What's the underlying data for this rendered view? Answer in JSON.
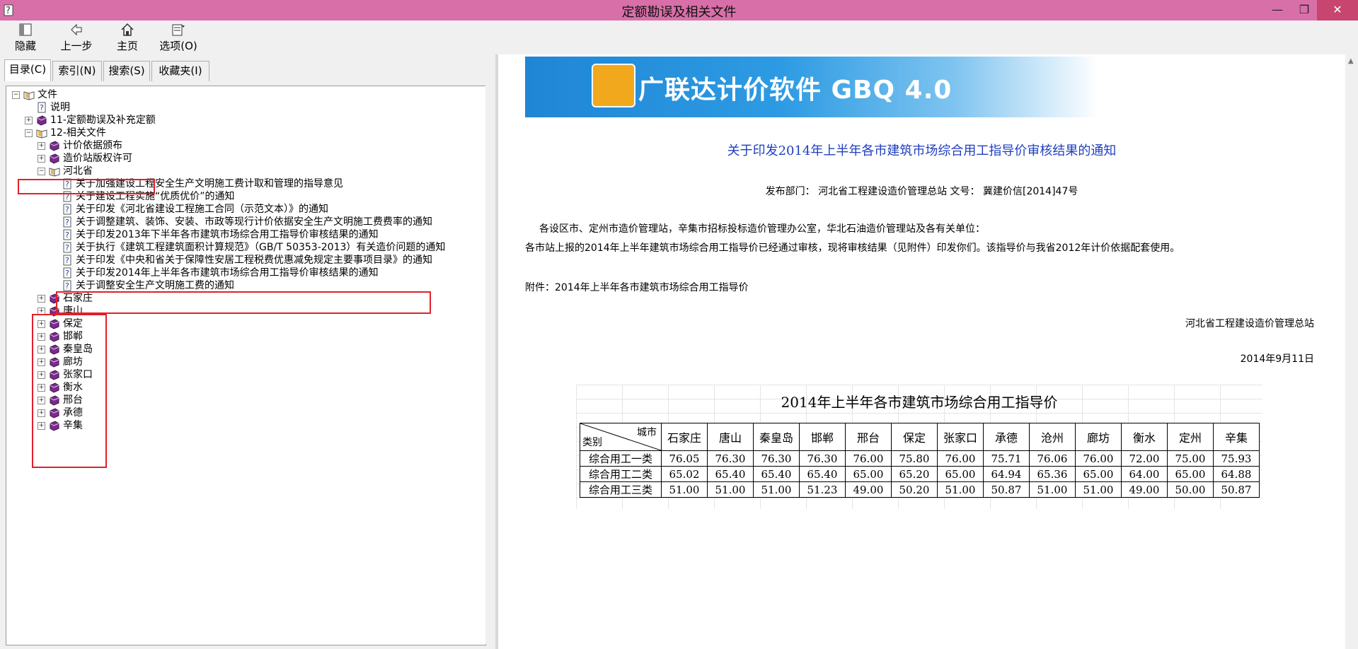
{
  "window": {
    "title": "定额勘误及相关文件"
  },
  "toolbar": [
    {
      "label": "隐藏",
      "icon": "hide-icon"
    },
    {
      "label": "上一步",
      "icon": "back-arrow-icon"
    },
    {
      "label": "主页",
      "icon": "home-icon"
    },
    {
      "label": "选项(O)",
      "icon": "options-icon"
    }
  ],
  "tabs": [
    "目录(C)",
    "索引(N)",
    "搜索(S)",
    "收藏夹(I)"
  ],
  "tree": [
    {
      "label": "文件",
      "level": 0,
      "icon": "open-book-icon",
      "toggle": "minus"
    },
    {
      "label": "说明",
      "level": 1,
      "icon": "help-page-icon",
      "toggle": ""
    },
    {
      "label": "11-定额勘误及补充定额",
      "level": 1,
      "icon": "book-icon",
      "toggle": "plus"
    },
    {
      "label": "12-相关文件",
      "level": 1,
      "icon": "open-book-icon",
      "toggle": "minus"
    },
    {
      "label": "计价依据颁布",
      "level": 2,
      "icon": "book-icon",
      "toggle": "plus"
    },
    {
      "label": "造价站版权许可",
      "level": 2,
      "icon": "book-icon",
      "toggle": "plus"
    },
    {
      "label": "河北省",
      "level": 2,
      "icon": "open-book-icon",
      "toggle": "minus"
    },
    {
      "label": "关于加强建设工程安全生产文明施工费计取和管理的指导意见",
      "level": 3,
      "icon": "help-page-icon",
      "toggle": ""
    },
    {
      "label": "关于建设工程实施“优质优价”的通知",
      "level": 3,
      "icon": "help-page-icon",
      "toggle": ""
    },
    {
      "label": "关于印发《河北省建设工程施工合同（示范文本）》的通知",
      "level": 3,
      "icon": "help-page-icon",
      "toggle": ""
    },
    {
      "label": "关于调整建筑、装饰、安装、市政等现行计价依据安全生产文明施工费费率的通知",
      "level": 3,
      "icon": "help-page-icon",
      "toggle": ""
    },
    {
      "label": "关于印发2013年下半年各市建筑市场综合用工指导价审核结果的通知",
      "level": 3,
      "icon": "help-page-icon",
      "toggle": ""
    },
    {
      "label": "关于执行《建筑工程建筑面积计算规范》（GB/T 50353-2013）有关造价问题的通知",
      "level": 3,
      "icon": "help-page-icon",
      "toggle": ""
    },
    {
      "label": "关于印发《中央和省关于保障性安居工程税费优惠减免规定主要事项目录》的通知",
      "level": 3,
      "icon": "help-page-icon",
      "toggle": ""
    },
    {
      "label": "关于印发2014年上半年各市建筑市场综合用工指导价审核结果的通知",
      "level": 3,
      "icon": "help-page-icon",
      "toggle": ""
    },
    {
      "label": "关于调整安全生产文明施工费的通知",
      "level": 3,
      "icon": "help-page-icon",
      "toggle": ""
    },
    {
      "label": "石家庄",
      "level": 2,
      "icon": "book-icon",
      "toggle": "plus"
    },
    {
      "label": "唐山",
      "level": 2,
      "icon": "book-icon",
      "toggle": "plus"
    },
    {
      "label": "保定",
      "level": 2,
      "icon": "book-icon",
      "toggle": "plus"
    },
    {
      "label": "邯郸",
      "level": 2,
      "icon": "book-icon",
      "toggle": "plus"
    },
    {
      "label": "秦皇岛",
      "level": 2,
      "icon": "book-icon",
      "toggle": "plus"
    },
    {
      "label": "廊坊",
      "level": 2,
      "icon": "book-icon",
      "toggle": "plus"
    },
    {
      "label": "张家口",
      "level": 2,
      "icon": "book-icon",
      "toggle": "plus"
    },
    {
      "label": "衡水",
      "level": 2,
      "icon": "book-icon",
      "toggle": "plus"
    },
    {
      "label": "邢台",
      "level": 2,
      "icon": "book-icon",
      "toggle": "plus"
    },
    {
      "label": "承德",
      "level": 2,
      "icon": "book-icon",
      "toggle": "plus"
    },
    {
      "label": "辛集",
      "level": 2,
      "icon": "book-icon",
      "toggle": "plus"
    }
  ],
  "document": {
    "banner_text": "广联达计价软件 GBQ 4.0",
    "title": "关于印发2014年上半年各市建筑市场综合用工指导价审核结果的通知",
    "meta": "发布部门：  河北省工程建设造价管理总站  文号：  冀建价信[2014]47号",
    "salutation": "各设区市、定州市造价管理站，辛集市招标投标造价管理办公室，华北石油造价管理站及各有关单位：",
    "body": "各市站上报的2014年上半年建筑市场综合用工指导价已经通过审核，现将审核结果（见附件）印发你们。该指导价与我省2012年计价依据配套使用。",
    "attachment": "附件：2014年上半年各市建筑市场综合用工指导价",
    "signature": "河北省工程建设造价管理总站",
    "date": "2014年9月11日",
    "table": {
      "title": "2014年上半年各市建筑市场综合用工指导价",
      "corner_top": "城市",
      "corner_bottom": "类别",
      "columns": [
        "石家庄",
        "唐山",
        "秦皇岛",
        "邯郸",
        "邢台",
        "保定",
        "张家口",
        "承德",
        "沧州",
        "廊坊",
        "衡水",
        "定州",
        "辛集"
      ],
      "rows": [
        {
          "category": "综合用工一类",
          "values": [
            "76.05",
            "76.30",
            "76.30",
            "76.30",
            "76.00",
            "75.80",
            "76.00",
            "75.71",
            "76.06",
            "76.00",
            "72.00",
            "75.00",
            "75.93"
          ]
        },
        {
          "category": "综合用工二类",
          "values": [
            "65.02",
            "65.40",
            "65.40",
            "65.40",
            "65.00",
            "65.20",
            "65.00",
            "64.94",
            "65.36",
            "65.00",
            "64.00",
            "65.00",
            "64.88"
          ]
        },
        {
          "category": "综合用工三类",
          "values": [
            "51.00",
            "51.00",
            "51.00",
            "51.23",
            "49.00",
            "50.20",
            "51.00",
            "50.87",
            "51.00",
            "51.00",
            "49.00",
            "50.00",
            "50.87"
          ]
        }
      ]
    }
  }
}
